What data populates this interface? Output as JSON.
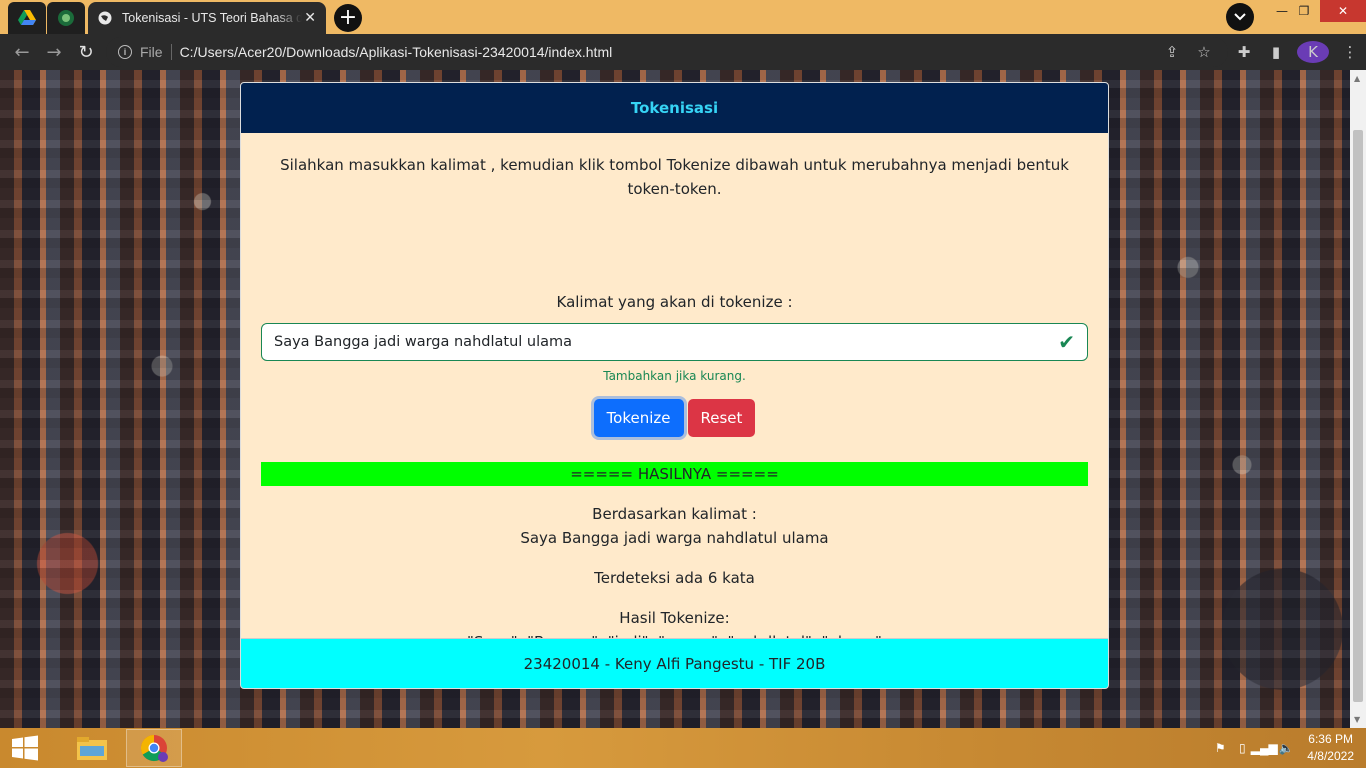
{
  "browser": {
    "tab_title": "Tokenisasi - UTS Teori Bahasa dan Automata",
    "address_scheme": "File",
    "address_url": "C:/Users/Acer20/Downloads/Aplikasi-Tokenisasi-23420014/index.html",
    "profile_initial": "K",
    "icons": [
      "google-drive-icon",
      "tab-favicon-icon",
      "globe-icon",
      "new-tab-icon",
      "tab-search-icon",
      "back-icon",
      "forward-icon",
      "reload-icon",
      "info-icon",
      "share-icon",
      "star-icon",
      "extensions-icon",
      "side-panel-icon"
    ]
  },
  "card": {
    "header": "Tokenisasi",
    "intro": "Silahkan masukkan kalimat , kemudian klik tombol Tokenize dibawah untuk merubahnya menjadi bentuk token-token.",
    "input_label": "Kalimat yang akan di tokenize :",
    "input_value": "Saya Bangga jadi warga nahdlatul ulama",
    "valid_feedback": "Tambahkan jika kurang.",
    "btn_tokenize": "Tokenize",
    "btn_reset": "Reset",
    "result_header": "===== HASILNYA =====",
    "based_on_label": "Berdasarkan kalimat :",
    "based_on_sentence": "Saya Bangga jadi warga nahdlatul ulama",
    "detected": "Terdeteksi ada 6 kata",
    "tokens_label": "Hasil Tokenize:",
    "tokens": "\"Saya\", \"Bangga\", \"jadi\", \"warga\", \"nahdlatul\", \"ulama\"",
    "footer": "23420014 - Keny Alfi Pangestu - TIF 20B",
    "colors": {
      "header_bg": "#01214f",
      "header_text": "#36d4f5",
      "body_bg": "#ffeacb",
      "result_bg": "#00ff00",
      "footer_bg": "#00ffff"
    }
  },
  "taskbar": {
    "time": "6:36 PM",
    "date": "4/8/2022"
  }
}
